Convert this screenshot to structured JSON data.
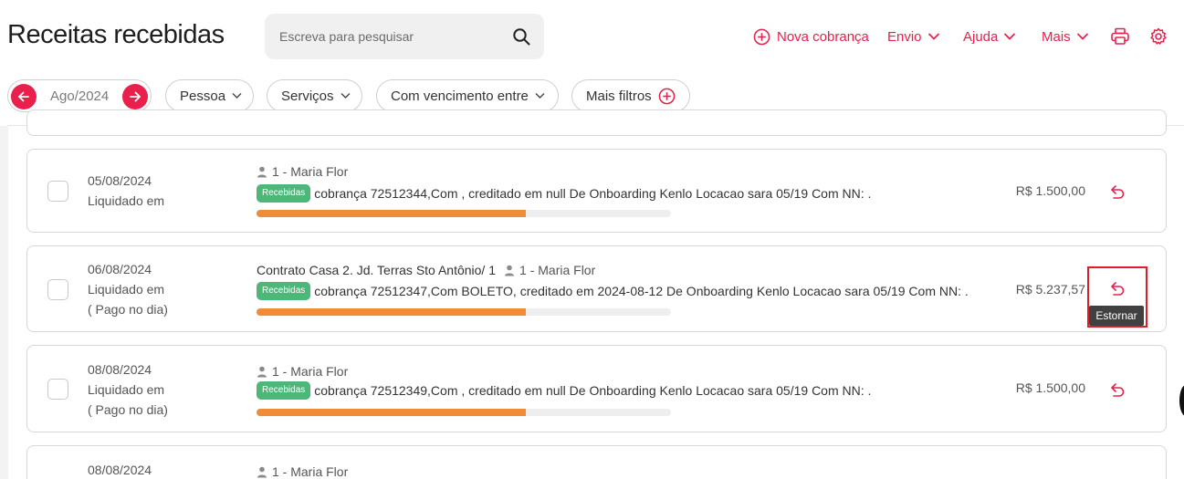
{
  "page": {
    "title": "Receitas recebidas"
  },
  "search": {
    "placeholder": "Escreva para pesquisar",
    "icon": "search-icon"
  },
  "top_actions": {
    "new_charge": "Nova cobrança",
    "send": "Envio",
    "help": "Ajuda",
    "more": "Mais",
    "print_icon": "printer-icon",
    "settings_icon": "gear-icon"
  },
  "filters": {
    "month": "Ago/2024",
    "person": "Pessoa",
    "services": "Serviços",
    "due_between": "Com vencimento entre",
    "more_filters": "Mais filtros"
  },
  "colors": {
    "accent": "#e8204b",
    "badge": "#4db77a",
    "progress": "#ef8c35"
  },
  "rows": [
    {
      "date": "05/08/2024",
      "status": "Liquidado em",
      "note": "",
      "contract": "",
      "person": "1 - Maria Flor",
      "badge": "Recebidas",
      "description": "cobrança 72512344,Com , creditado em null  De Onboarding Kenlo Locacao sara 05/19 Com NN: .",
      "progress": 0.65,
      "amount": "R$ 1.500,00"
    },
    {
      "date": "06/08/2024",
      "status": "Liquidado em",
      "note": "( Pago no dia)",
      "contract": "Contrato Casa 2. Jd. Terras Sto Antônio/ 1",
      "person": "1 - Maria Flor",
      "badge": "Recebidas",
      "description": "cobrança 72512347,Com BOLETO, creditado em 2024-08-12  De Onboarding Kenlo Locacao sara 05/19 Com NN: .",
      "progress": 0.65,
      "amount": "R$ 5.237,57"
    },
    {
      "date": "08/08/2024",
      "status": "Liquidado em",
      "note": "( Pago no dia)",
      "contract": "",
      "person": "1 - Maria Flor",
      "badge": "Recebidas",
      "description": "cobrança 72512349,Com , creditado em null  De Onboarding Kenlo Locacao sara 05/19 Com NN: .",
      "progress": 0.65,
      "amount": "R$ 1.500,00"
    },
    {
      "date": "08/08/2024",
      "person": "1 - Maria Flor"
    }
  ],
  "tooltip": {
    "reverse": "Estornar"
  }
}
